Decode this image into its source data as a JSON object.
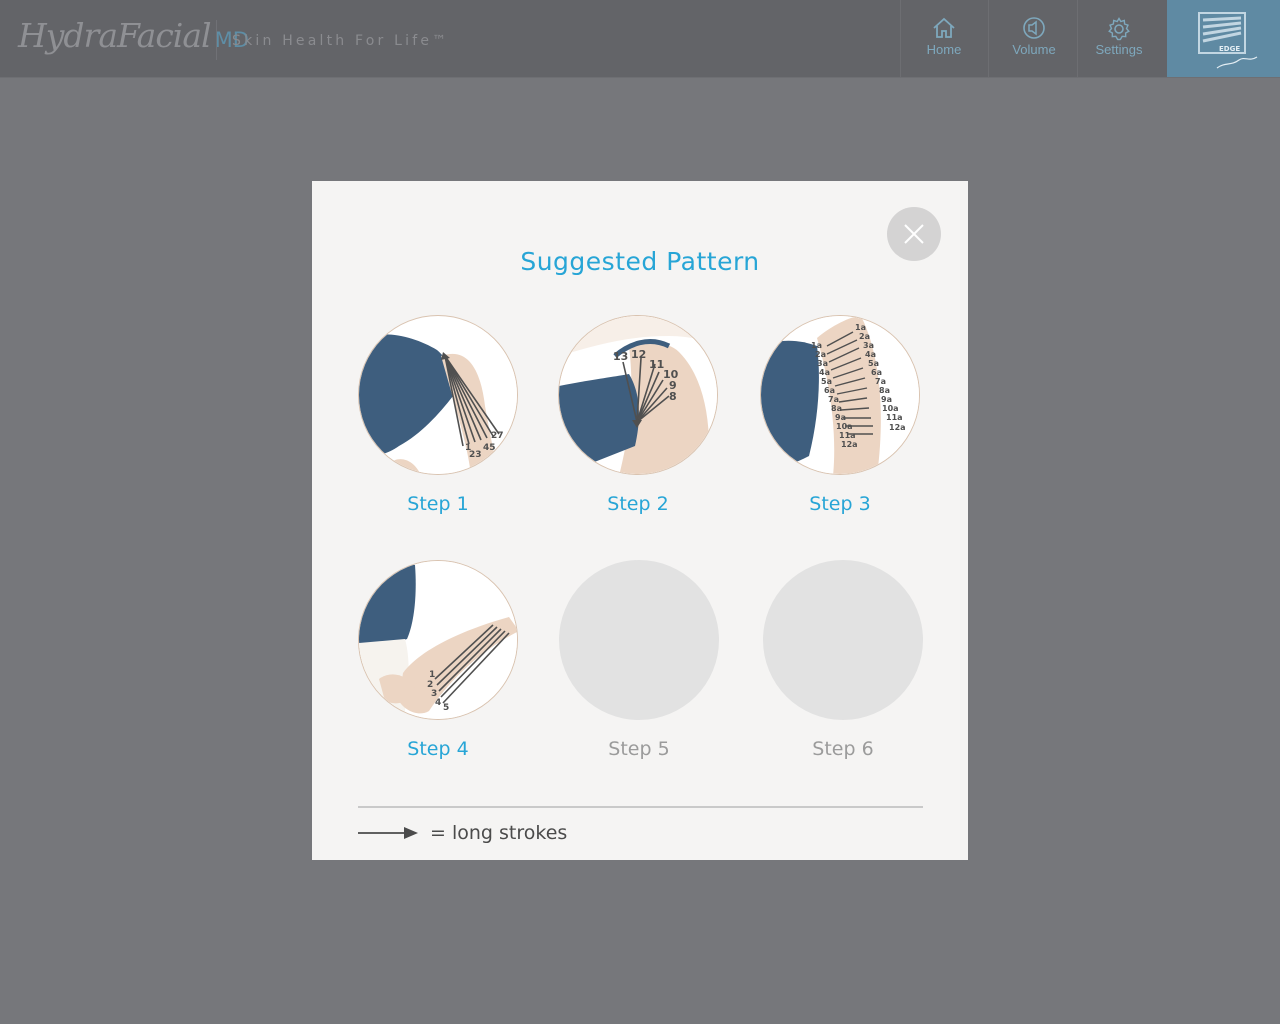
{
  "header": {
    "logo_script": "HydraFacial",
    "logo_suffix": "MD",
    "tagline": "Skin Health For Life™",
    "nav": [
      {
        "label": "Home",
        "icon": "home-icon"
      },
      {
        "label": "Volume",
        "icon": "speaker-icon"
      },
      {
        "label": "Settings",
        "icon": "gear-icon"
      }
    ],
    "edge_logo": {
      "label": "EDGE",
      "icon": "edge-logo"
    }
  },
  "modal": {
    "title": "Suggested Pattern",
    "close_icon": "close-icon",
    "steps": [
      {
        "label": "Step 1",
        "enabled": true,
        "icon": "arm-pattern-image"
      },
      {
        "label": "Step 2",
        "enabled": true,
        "icon": "shoulder-pattern-image"
      },
      {
        "label": "Step 3",
        "enabled": true,
        "icon": "back-arm-pattern-image"
      },
      {
        "label": "Step 4",
        "enabled": true,
        "icon": "forearm-pattern-image"
      },
      {
        "label": "Step 5",
        "enabled": false
      },
      {
        "label": "Step 6",
        "enabled": false
      }
    ],
    "legend": {
      "text": "= long strokes",
      "icon": "arrow-right-icon"
    }
  },
  "colors": {
    "accent": "#27a5d6",
    "disabled_text": "#9b9b9b",
    "backdrop": "#76777b",
    "topbar": "#636468",
    "edge_tile": "#5f8aa3"
  }
}
